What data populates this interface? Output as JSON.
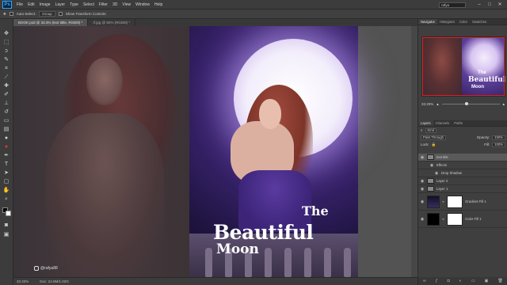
{
  "app": {
    "logo": "Ps",
    "search_placeholder": "rafya"
  },
  "menu": [
    "File",
    "Edit",
    "Image",
    "Layer",
    "Type",
    "Select",
    "Filter",
    "3D",
    "View",
    "Window",
    "Help"
  ],
  "window_buttons": [
    "–",
    "□",
    "✕"
  ],
  "options_bar": {
    "auto_select_label": "Auto-Select:",
    "auto_select_value": "Group",
    "transform_label": "Show Transform Controls"
  },
  "doc_tabs": [
    "BOOK.psd @ 33.3% (text tittle, RGB/8) *",
    "rf.jpg @ 50% (RGB/8) *"
  ],
  "canvas": {
    "title_the": "The",
    "title_beautiful": "Beautiful",
    "title_moon": "Moon",
    "watermark": "@rafya88"
  },
  "status": {
    "zoom": "33.33%",
    "doc_info": "Doc: 24.9M/1.02G"
  },
  "panels": {
    "top_tabs": [
      "Navigator",
      "Histogram",
      "Color",
      "Swatches"
    ],
    "navigator": {
      "title_the": "The",
      "title_beautiful": "Beautiful",
      "title_moon": "Moon",
      "zoom": "33.33%"
    },
    "layer_tabs": [
      "Layers",
      "Channels",
      "Paths"
    ],
    "kind_label": "Kind",
    "blend_mode": "Pass Through",
    "opacity_label": "Opacity:",
    "opacity_value": "100%",
    "lock_label": "Lock:",
    "fill_label": "Fill:",
    "fill_value": "100%",
    "layers": [
      {
        "name": "text title"
      },
      {
        "name": "Effects"
      },
      {
        "name": "Drop Shadow"
      },
      {
        "name": "Layer 2"
      },
      {
        "name": "Layer 1"
      },
      {
        "name": "Gradient Fill 1"
      },
      {
        "name": "Color Fill 1"
      }
    ]
  },
  "colors": {
    "accent": "#31a8ff",
    "nav_frame": "#e02020"
  }
}
